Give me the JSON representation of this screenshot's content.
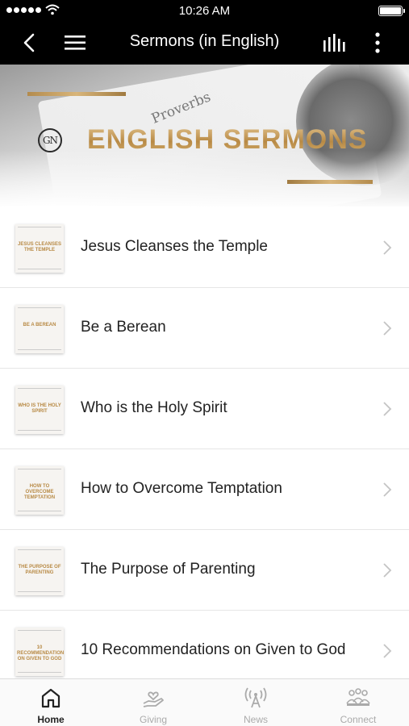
{
  "status_bar": {
    "time": "10:26 AM"
  },
  "nav": {
    "title": "Sermons (in English)",
    "back_icon": "back-chevron-icon",
    "menu_icon": "hamburger-menu-icon",
    "audio_icon": "audio-bars-icon",
    "more_icon": "vertical-dots-icon"
  },
  "banner": {
    "logo_text": "GN",
    "heading": "ENGLISH SERMONS",
    "book_word": "Proverbs",
    "accent_color": "#c49a5a"
  },
  "sermons": [
    {
      "title": "Jesus Cleanses the Temple",
      "thumb_text": "JESUS CLEANSES THE TEMPLE"
    },
    {
      "title": "Be a Berean",
      "thumb_text": "BE A BEREAN"
    },
    {
      "title": "Who is the Holy Spirit",
      "thumb_text": "WHO IS THE HOLY SPIRIT"
    },
    {
      "title": "How to Overcome Temptation",
      "thumb_text": "HOW TO OVERCOME TEMPTATION"
    },
    {
      "title": "The Purpose of Parenting",
      "thumb_text": "THE PURPOSE OF PARENTING"
    },
    {
      "title": "10 Recommendations on Given to God",
      "thumb_text": "10 RECOMMENDATIONS ON GIVEN TO GOD"
    }
  ],
  "tabs": [
    {
      "label": "Home",
      "icon": "home-icon",
      "active": true
    },
    {
      "label": "Giving",
      "icon": "giving-hand-heart-icon",
      "active": false
    },
    {
      "label": "News",
      "icon": "broadcast-tower-icon",
      "active": false
    },
    {
      "label": "Connect",
      "icon": "people-group-icon",
      "active": false
    }
  ]
}
